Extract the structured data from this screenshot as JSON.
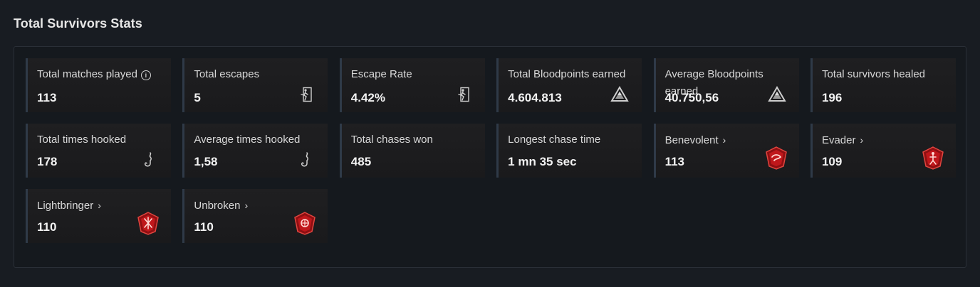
{
  "section": {
    "title": "Total Survivors Stats"
  },
  "colors": {
    "background": "#181c22",
    "card": "#1e1e20",
    "card_accent": "#2f3a48",
    "badge_red": "#c0171b"
  },
  "cards": [
    {
      "label": "Total matches played",
      "value": "113",
      "icon": "info-icon"
    },
    {
      "label": "Total escapes",
      "value": "5",
      "icon": "exit-door-icon"
    },
    {
      "label": "Escape Rate",
      "value": "4.42%",
      "icon": "exit-door-icon"
    },
    {
      "label": "Total Bloodpoints earned",
      "value": "4.604.813",
      "icon": "bloodpoints-icon"
    },
    {
      "label": "Average Bloodpoints earned",
      "value": "40.750,56",
      "icon": "bloodpoints-icon"
    },
    {
      "label": "Total survivors healed",
      "value": "196",
      "icon": ""
    },
    {
      "label": "Total times hooked",
      "value": "178",
      "icon": "hook-icon"
    },
    {
      "label": "Average times hooked",
      "value": "1,58",
      "icon": "hook-icon"
    },
    {
      "label": "Total chases won",
      "value": "485",
      "icon": ""
    },
    {
      "label": "Longest chase time",
      "value": "1 mn 35 sec",
      "icon": ""
    },
    {
      "label": "Benevolent",
      "value": "113",
      "icon": "benevolent-badge-icon"
    },
    {
      "label": "Evader",
      "value": "109",
      "icon": "evader-badge-icon"
    },
    {
      "label": "Lightbringer",
      "value": "110",
      "icon": "lightbringer-badge-icon"
    },
    {
      "label": "Unbroken",
      "value": "110",
      "icon": "unbroken-badge-icon"
    }
  ]
}
